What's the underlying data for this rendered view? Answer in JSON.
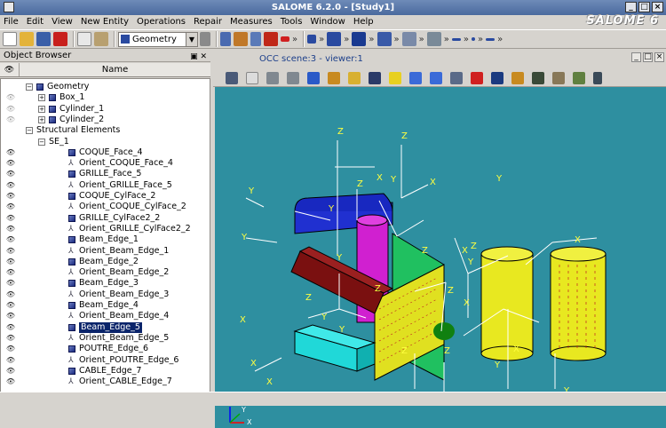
{
  "window": {
    "title": "SALOME 6.2.0 - [Study1]",
    "brand": "SALOME 6"
  },
  "menu": [
    "File",
    "Edit",
    "View",
    "New Entity",
    "Operations",
    "Repair",
    "Measures",
    "Tools",
    "Window",
    "Help"
  ],
  "toolbar": {
    "module_combo": "Geometry"
  },
  "object_browser": {
    "title": "Object Browser",
    "column_name": "Name",
    "items": [
      {
        "label": "Geometry",
        "depth": 0,
        "expander": "−",
        "icon": "geometry-icon",
        "visible": null
      },
      {
        "label": "Box_1",
        "depth": 1,
        "expander": "+",
        "icon": "solid-icon",
        "visible": "dim"
      },
      {
        "label": "Cylinder_1",
        "depth": 1,
        "expander": "+",
        "icon": "solid-icon",
        "visible": "dim"
      },
      {
        "label": "Cylinder_2",
        "depth": 1,
        "expander": "+",
        "icon": "solid-icon",
        "visible": "dim"
      },
      {
        "label": "Structural Elements",
        "depth": 0,
        "expander": "−",
        "icon": "",
        "visible": null
      },
      {
        "label": "SE_1",
        "depth": 1,
        "expander": "−",
        "icon": "",
        "visible": null
      },
      {
        "label": "COQUE_Face_4",
        "depth": 2,
        "icon": "solid-icon",
        "visible": "on"
      },
      {
        "label": "Orient_COQUE_Face_4",
        "depth": 2,
        "icon": "orientation-icon",
        "visible": "on"
      },
      {
        "label": "GRILLE_Face_5",
        "depth": 2,
        "icon": "solid-icon",
        "visible": "on"
      },
      {
        "label": "Orient_GRILLE_Face_5",
        "depth": 2,
        "icon": "orientation-icon",
        "visible": "on"
      },
      {
        "label": "COQUE_CylFace_2",
        "depth": 2,
        "icon": "solid-icon",
        "visible": "on"
      },
      {
        "label": "Orient_COQUE_CylFace_2",
        "depth": 2,
        "icon": "orientation-icon",
        "visible": "on"
      },
      {
        "label": "GRILLE_CylFace2_2",
        "depth": 2,
        "icon": "solid-icon",
        "visible": "on"
      },
      {
        "label": "Orient_GRILLE_CylFace2_2",
        "depth": 2,
        "icon": "orientation-icon",
        "visible": "on"
      },
      {
        "label": "Beam_Edge_1",
        "depth": 2,
        "icon": "solid-icon",
        "visible": "on"
      },
      {
        "label": "Orient_Beam_Edge_1",
        "depth": 2,
        "icon": "orientation-icon",
        "visible": "on"
      },
      {
        "label": "Beam_Edge_2",
        "depth": 2,
        "icon": "solid-icon",
        "visible": "on"
      },
      {
        "label": "Orient_Beam_Edge_2",
        "depth": 2,
        "icon": "orientation-icon",
        "visible": "on"
      },
      {
        "label": "Beam_Edge_3",
        "depth": 2,
        "icon": "solid-icon",
        "visible": "on"
      },
      {
        "label": "Orient_Beam_Edge_3",
        "depth": 2,
        "icon": "orientation-icon",
        "visible": "on"
      },
      {
        "label": "Beam_Edge_4",
        "depth": 2,
        "icon": "solid-icon",
        "visible": "on"
      },
      {
        "label": "Orient_Beam_Edge_4",
        "depth": 2,
        "icon": "orientation-icon",
        "visible": "on"
      },
      {
        "label": "Beam_Edge_5",
        "depth": 2,
        "icon": "solid-icon",
        "visible": "on",
        "selected": true
      },
      {
        "label": "Orient_Beam_Edge_5",
        "depth": 2,
        "icon": "orientation-icon",
        "visible": "on"
      },
      {
        "label": "POUTRE_Edge_6",
        "depth": 2,
        "icon": "solid-icon",
        "visible": "on"
      },
      {
        "label": "Orient_POUTRE_Edge_6",
        "depth": 2,
        "icon": "orientation-icon",
        "visible": "on"
      },
      {
        "label": "CABLE_Edge_7",
        "depth": 2,
        "icon": "solid-icon",
        "visible": "on"
      },
      {
        "label": "Orient_CABLE_Edge_7",
        "depth": 2,
        "icon": "orientation-icon",
        "visible": "on"
      }
    ]
  },
  "viewer": {
    "tab_title": "OCC scene:3 - viewer:1",
    "background": "#2e8fa0",
    "axis_labels": {
      "x": "X",
      "y": "Y",
      "z": "Z"
    }
  }
}
